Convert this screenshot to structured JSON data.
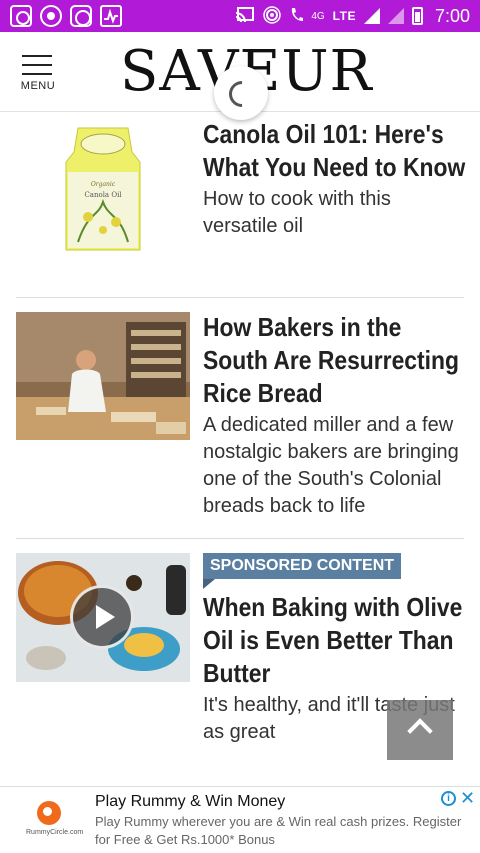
{
  "status_bar": {
    "network_label": "4G",
    "lte_label": "LTE",
    "time": "7:00",
    "background_color": "#b11ad6"
  },
  "header": {
    "menu_label": "MENU",
    "logo_text": "SAVEUR"
  },
  "articles": [
    {
      "title": "Canola Oil 101: Here's What You Need to Know",
      "subtitle": "How to cook with this versatile oil",
      "image_label": "Canola Oil",
      "image_brand": "Organic"
    },
    {
      "title": "How Bakers in the South Are Resurrecting Rice Bread",
      "subtitle": "A dedicated miller and a few nostalgic bakers are bringing one of the South's Colonial breads back to life"
    },
    {
      "badge": "SPONSORED CONTENT",
      "title": "When Baking with Olive Oil is Even Better Than Butter",
      "subtitle": "It's healthy, and it'll taste just as great"
    }
  ],
  "ad": {
    "title": "Play Rummy & Win Money",
    "description": "Play Rummy wherever you are & Win real cash prizes. Register for Free & Get Rs.1000* Bonus",
    "advertiser_logo_text": "RummyCircle.com",
    "info_icon": "i",
    "close_icon": "✕"
  },
  "colors": {
    "sponsored_badge": "#5a7fa0",
    "ad_accent": "#1a8fd6"
  }
}
